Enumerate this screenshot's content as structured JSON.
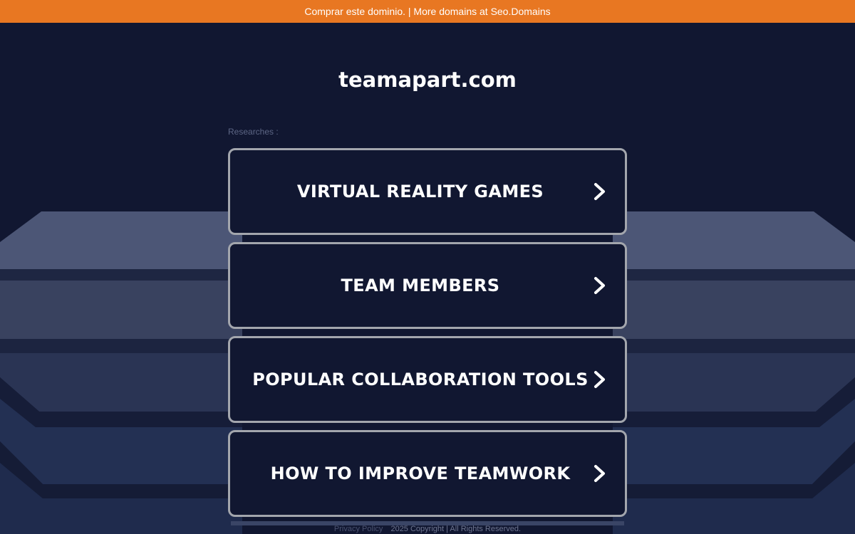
{
  "banner": {
    "text": "Comprar este dominio. | More domains at Seo.Domains"
  },
  "site": {
    "domain": "teamapart.com"
  },
  "researches_label": "Researches :",
  "links": [
    {
      "label": "VIRTUAL REALITY GAMES",
      "icon": "chevron-right-icon"
    },
    {
      "label": "TEAM MEMBERS",
      "icon": "chevron-right-icon"
    },
    {
      "label": "POPULAR COLLABORATION TOOLS",
      "icon": "chevron-right-icon"
    },
    {
      "label": "HOW TO IMPROVE TEAMWORK",
      "icon": "chevron-right-icon"
    }
  ],
  "footer": {
    "privacy_label": "Privacy Policy",
    "copyright": "2025 Copyright | All Rights Reserved."
  },
  "colors": {
    "background": "#111731",
    "banner": "#e87722",
    "button_border": "#a3a6ad",
    "text": "#ffffff"
  }
}
